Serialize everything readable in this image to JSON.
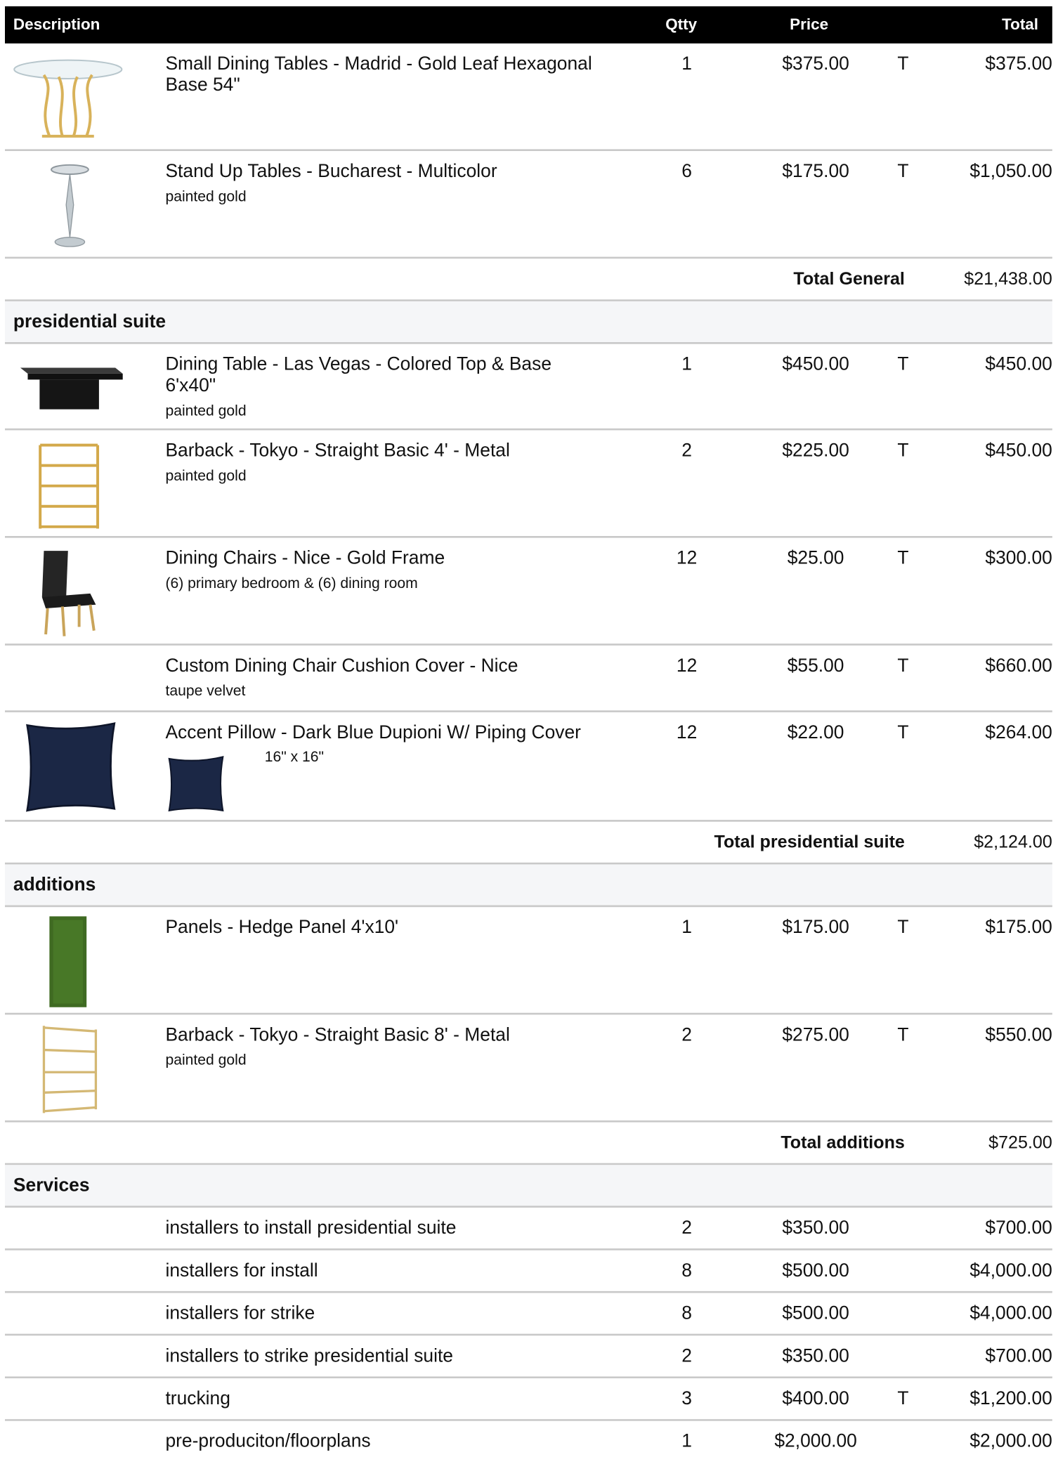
{
  "header": {
    "description": "Description",
    "qty": "Qtty",
    "price": "Price",
    "total": "Total"
  },
  "general": {
    "items": [
      {
        "name": "Small Dining Tables - Madrid - Gold Leaf Hexagonal Base 54\"",
        "note": "",
        "qty": "1",
        "price": "$375.00",
        "tax": "T",
        "total": "$375.00",
        "icon": "glass-table-icon"
      },
      {
        "name": "Stand Up Tables - Bucharest - Multicolor",
        "note": "painted gold",
        "qty": "6",
        "price": "$175.00",
        "tax": "T",
        "total": "$1,050.00",
        "icon": "pedestal-table-icon"
      }
    ],
    "total_label": "Total General",
    "total_value": "$21,438.00"
  },
  "presidential": {
    "section": "presidential suite",
    "items": [
      {
        "name": "Dining Table - Las Vegas - Colored Top & Base 6'x40\"",
        "note": "painted gold",
        "qty": "1",
        "price": "$450.00",
        "tax": "T",
        "total": "$450.00",
        "icon": "black-table-icon"
      },
      {
        "name": "Barback - Tokyo - Straight Basic 4' - Metal",
        "note": "painted gold",
        "qty": "2",
        "price": "$225.00",
        "tax": "T",
        "total": "$450.00",
        "icon": "shelf-icon"
      },
      {
        "name": "Dining Chairs - Nice - Gold Frame",
        "note": "(6) primary bedroom & (6) dining room",
        "qty": "12",
        "price": "$25.00",
        "tax": "T",
        "total": "$300.00",
        "icon": "chair-icon"
      },
      {
        "name": "Custom Dining Chair Cushion Cover - Nice",
        "note": "taupe velvet",
        "qty": "12",
        "price": "$55.00",
        "tax": "T",
        "total": "$660.00",
        "icon": ""
      },
      {
        "name": "Accent Pillow - Dark Blue Dupioni W/ Piping Cover",
        "note": "16\" x 16\"",
        "qty": "12",
        "price": "$22.00",
        "tax": "T",
        "total": "$264.00",
        "icon": "pillow-icon"
      }
    ],
    "total_label": "Total presidential suite",
    "total_value": "$2,124.00"
  },
  "additions": {
    "section": "additions",
    "items": [
      {
        "name": "Panels - Hedge Panel 4'x10'",
        "note": "",
        "qty": "1",
        "price": "$175.00",
        "tax": "T",
        "total": "$175.00",
        "icon": "hedge-panel-icon"
      },
      {
        "name": "Barback - Tokyo - Straight Basic 8' - Metal",
        "note": "painted gold",
        "qty": "2",
        "price": "$275.00",
        "tax": "T",
        "total": "$550.00",
        "icon": "tall-shelf-icon"
      }
    ],
    "total_label": "Total additions",
    "total_value": "$725.00"
  },
  "services": {
    "section": "Services",
    "items": [
      {
        "name": "installers to install presidential suite",
        "qty": "2",
        "price": "$350.00",
        "tax": "",
        "total": "$700.00"
      },
      {
        "name": "installers for install",
        "qty": "8",
        "price": "$500.00",
        "tax": "",
        "total": "$4,000.00"
      },
      {
        "name": "installers for strike",
        "qty": "8",
        "price": "$500.00",
        "tax": "",
        "total": "$4,000.00"
      },
      {
        "name": "installers to strike presidential suite",
        "qty": "2",
        "price": "$350.00",
        "tax": "",
        "total": "$700.00"
      },
      {
        "name": "trucking",
        "qty": "3",
        "price": "$400.00",
        "tax": "T",
        "total": "$1,200.00"
      },
      {
        "name": "pre-produciton/floorplans",
        "qty": "1",
        "price": "$2,000.00",
        "tax": "",
        "total": "$2,000.00"
      }
    ]
  }
}
